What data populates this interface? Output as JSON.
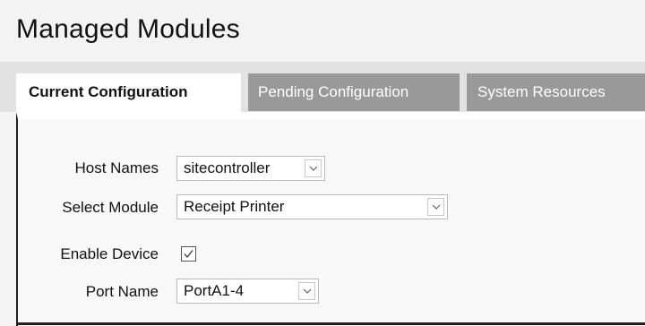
{
  "header": {
    "title": "Managed Modules"
  },
  "tabs": [
    {
      "label": "Current Configuration",
      "active": true
    },
    {
      "label": "Pending Configuration",
      "active": false
    },
    {
      "label": "System Resources",
      "active": false
    }
  ],
  "form": {
    "host_names": {
      "label": "Host Names",
      "value": "sitecontroller"
    },
    "select_module": {
      "label": "Select Module",
      "value": "Receipt Printer"
    },
    "enable_device": {
      "label": "Enable Device",
      "checked": true
    },
    "port_name": {
      "label": "Port Name",
      "value": "PortA1-4"
    }
  },
  "icons": {
    "dropdown": "chevron-down-icon",
    "check": "check-icon"
  },
  "colors": {
    "active_tab_bg": "#ffffff",
    "inactive_tab_bg": "#999999",
    "inactive_tab_text": "#ffffff",
    "page_bg": "#f3f3f3"
  }
}
